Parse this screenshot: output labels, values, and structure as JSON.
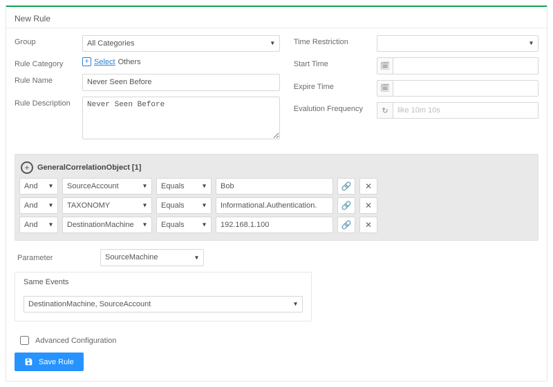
{
  "panel": {
    "title": "New Rule"
  },
  "labels": {
    "group": "Group",
    "rule_category": "Rule Category",
    "rule_name": "Rule Name",
    "rule_description": "Rule Description",
    "time_restriction": "Time Restriction",
    "start_time": "Start Time",
    "expire_time": "Expire Time",
    "evaluation_frequency": "Evalution Frequency",
    "parameter": "Parameter",
    "same_events": "Same Events",
    "advanced_config": "Advanced Configuration"
  },
  "form": {
    "group": "All Categories",
    "rule_category_select_text": "Select",
    "rule_category_value": "Others",
    "rule_name": "Never Seen Before",
    "rule_description": "Never Seen Before",
    "time_restriction": "",
    "start_time": "",
    "expire_time": "",
    "eval_freq_placeholder": "like 10m 10s",
    "parameter": "SourceMachine",
    "same_events_value": "DestinationMachine, SourceAccount",
    "advanced_checked": false
  },
  "criteria": {
    "header": "GeneralCorrelationObject [1]",
    "rows": [
      {
        "bool": "And",
        "field": "SourceAccount",
        "op": "Equals",
        "value": "Bob"
      },
      {
        "bool": "And",
        "field": "TAXONOMY",
        "op": "Equals",
        "value": "Informational.Authentication."
      },
      {
        "bool": "And",
        "field": "DestinationMachine",
        "op": "Equals",
        "value": "192.168.1.100"
      }
    ]
  },
  "buttons": {
    "save": "Save Rule"
  },
  "icons": {
    "calendar": "calendar-icon",
    "refresh": "refresh-icon",
    "link": "link-icon",
    "remove": "remove-icon",
    "add": "add-circle-icon",
    "floppy": "floppy-icon",
    "select_plus": "select-plus-icon"
  }
}
